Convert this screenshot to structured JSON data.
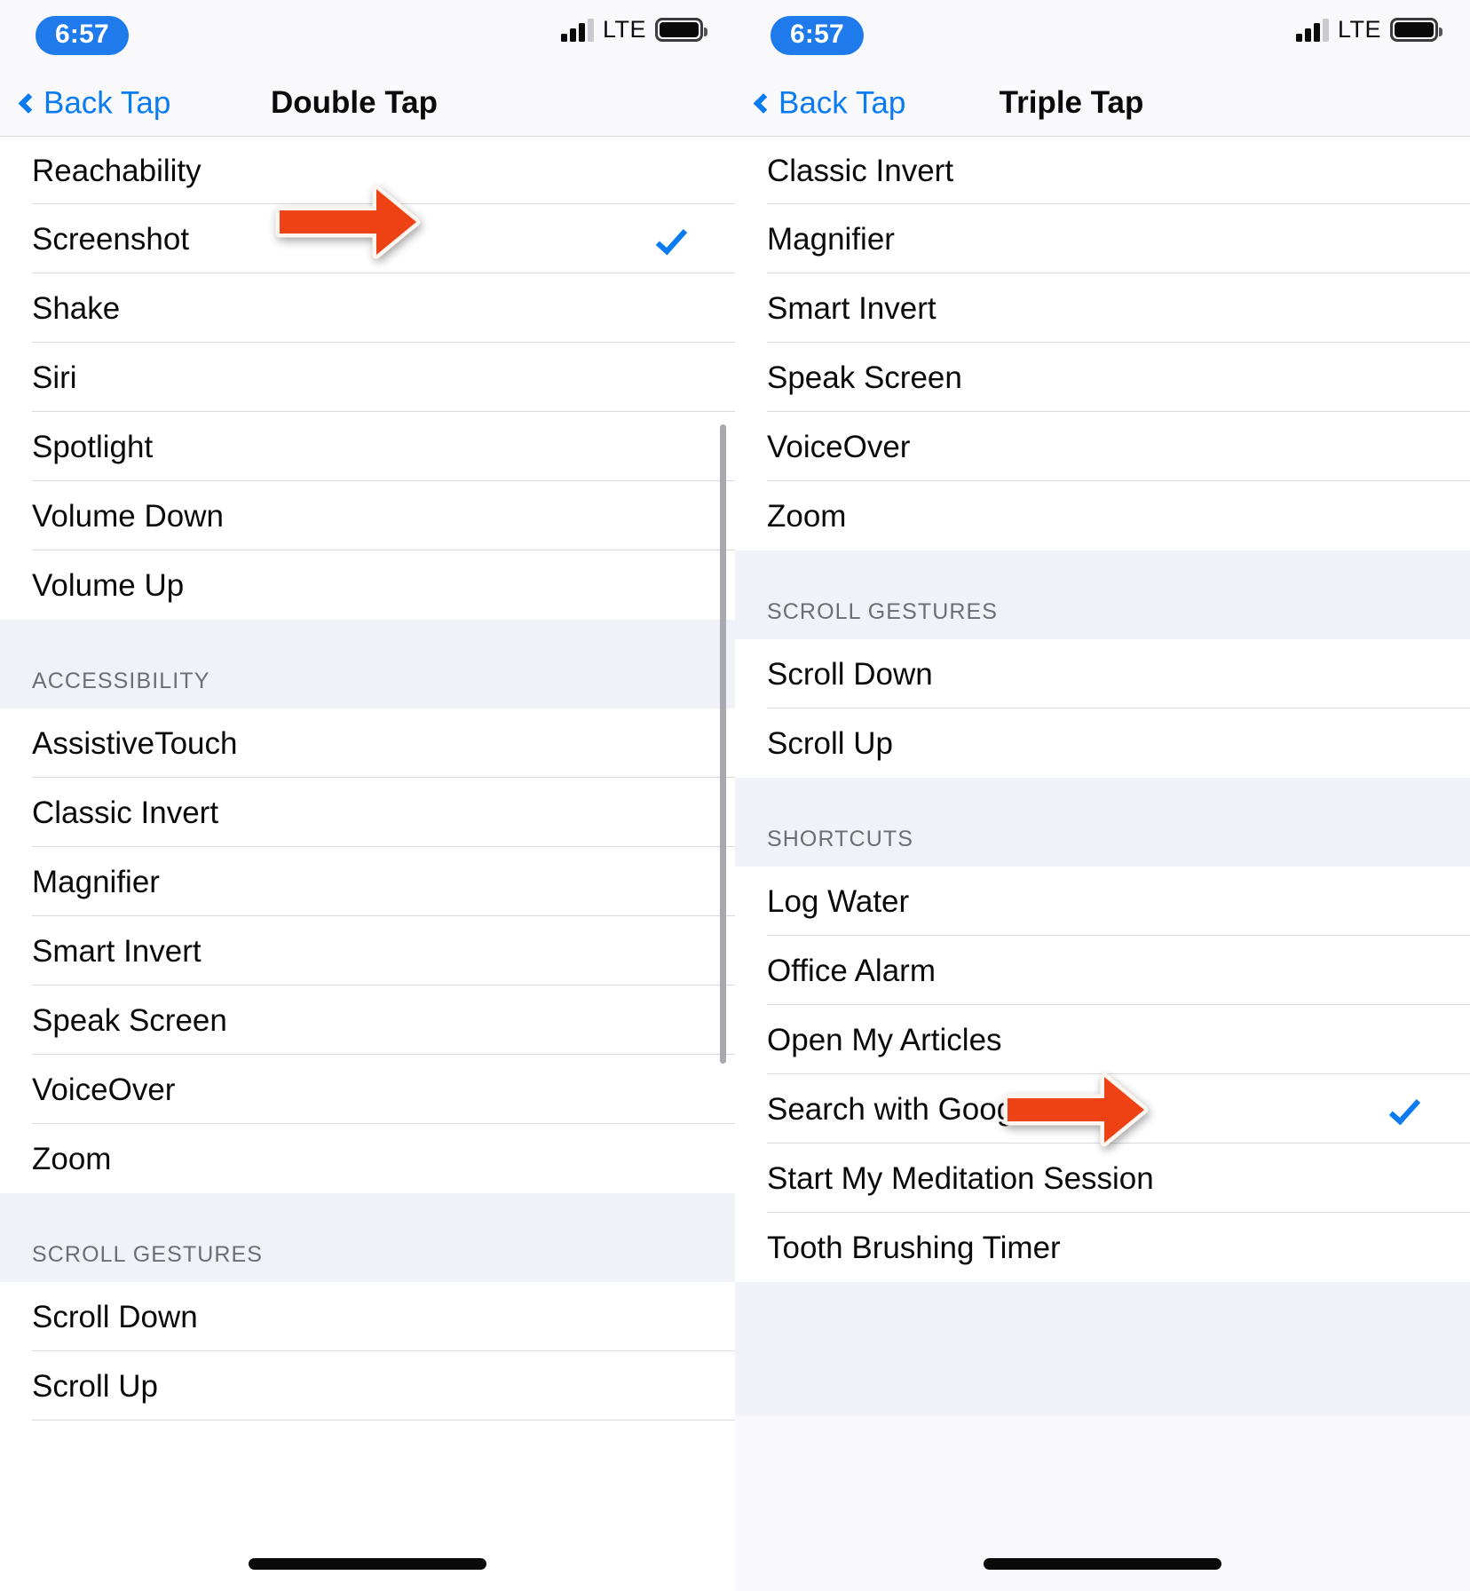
{
  "meta": {
    "accent_blue": "#0b7bf1",
    "arrow_color": "#ef4214",
    "section_bg": "#f1f1f8"
  },
  "panels": [
    {
      "id": "double-tap",
      "statusbar": {
        "time": "6:57",
        "carrier_tech": "LTE",
        "signal_bars_filled": 3,
        "signal_bars_total": 4,
        "battery_full": true
      },
      "navbar": {
        "back_label": "Back Tap",
        "title": "Double Tap"
      },
      "sections": [
        {
          "header": null,
          "rows": [
            {
              "label": "Reachability",
              "checked": false
            },
            {
              "label": "Screenshot",
              "checked": true
            },
            {
              "label": "Shake",
              "checked": false
            },
            {
              "label": "Siri",
              "checked": false
            },
            {
              "label": "Spotlight",
              "checked": false
            },
            {
              "label": "Volume Down",
              "checked": false
            },
            {
              "label": "Volume Up",
              "checked": false
            }
          ]
        },
        {
          "header": "ACCESSIBILITY",
          "rows": [
            {
              "label": "AssistiveTouch",
              "checked": false
            },
            {
              "label": "Classic Invert",
              "checked": false
            },
            {
              "label": "Magnifier",
              "checked": false
            },
            {
              "label": "Smart Invert",
              "checked": false
            },
            {
              "label": "Speak Screen",
              "checked": false
            },
            {
              "label": "VoiceOver",
              "checked": false
            },
            {
              "label": "Zoom",
              "checked": false
            }
          ]
        },
        {
          "header": "SCROLL GESTURES",
          "rows": [
            {
              "label": "Scroll Down",
              "checked": false
            },
            {
              "label": "Scroll Up",
              "checked": false
            }
          ]
        }
      ],
      "annotation": {
        "kind": "left-arrow",
        "target_row": "Screenshot"
      }
    },
    {
      "id": "triple-tap",
      "statusbar": {
        "time": "6:57",
        "carrier_tech": "LTE",
        "signal_bars_filled": 3,
        "signal_bars_total": 4,
        "battery_full": true
      },
      "navbar": {
        "back_label": "Back Tap",
        "title": "Triple Tap"
      },
      "sections": [
        {
          "header": null,
          "rows": [
            {
              "label": "Classic Invert",
              "checked": false
            },
            {
              "label": "Magnifier",
              "checked": false
            },
            {
              "label": "Smart Invert",
              "checked": false
            },
            {
              "label": "Speak Screen",
              "checked": false
            },
            {
              "label": "VoiceOver",
              "checked": false
            },
            {
              "label": "Zoom",
              "checked": false
            }
          ]
        },
        {
          "header": "SCROLL GESTURES",
          "rows": [
            {
              "label": "Scroll Down",
              "checked": false
            },
            {
              "label": "Scroll Up",
              "checked": false
            }
          ]
        },
        {
          "header": "SHORTCUTS",
          "rows": [
            {
              "label": "Log Water",
              "checked": false
            },
            {
              "label": "Office Alarm",
              "checked": false
            },
            {
              "label": "Open My Articles",
              "checked": false
            },
            {
              "label": "Search with Google",
              "checked": true
            },
            {
              "label": "Start My Meditation Session",
              "checked": false
            },
            {
              "label": "Tooth Brushing Timer",
              "checked": false
            }
          ]
        }
      ],
      "annotation": {
        "kind": "left-arrow",
        "target_row": "Search with Google"
      }
    }
  ]
}
